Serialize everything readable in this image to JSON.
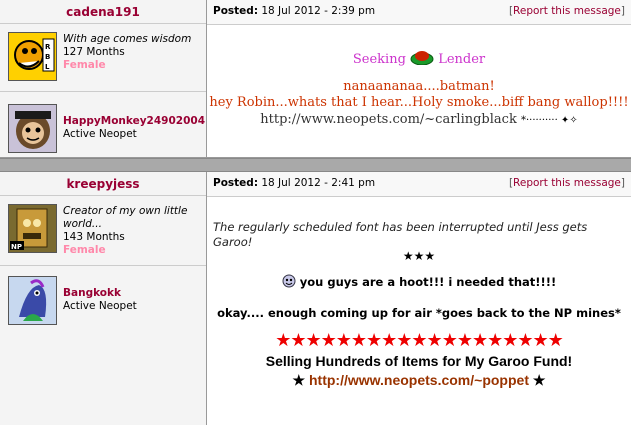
{
  "post1": {
    "username": "cadena191",
    "quote": "With age comes wisdom",
    "months": "127 Months",
    "gender": "Female",
    "pet_name": "HappyMonkey24902004",
    "pet_status": "Active Neopet",
    "posted_label": "Posted:",
    "posted_date": "18 Jul 2012 - 2:39 pm",
    "report_open": "[",
    "report_label": "Report this message",
    "report_close": "]",
    "seeking": "Seeking",
    "lender": "Lender",
    "line1": "nanaananaa....batman!",
    "line2": "hey Robin...whats that I hear...Holy smoke...biff bang wallop!!!!",
    "link": "http://www.neopets.com/~carlingblack",
    "sparkles": "*·········· ✦✧"
  },
  "post2": {
    "username": "kreepyjess",
    "quote": "Creator of my own little world...",
    "months": "143 Months",
    "gender": "Female",
    "pet_name": "Bangkokk",
    "pet_status": "Active Neopet",
    "posted_label": "Posted:",
    "posted_date": "18 Jul 2012 - 2:41 pm",
    "report_open": "[",
    "report_label": "Report this message",
    "report_close": "]",
    "intro": "The regularly scheduled font has been interrupted until Jess gets Garoo!",
    "stars3": "★★★",
    "hoot": "you guys are a hoot!!! i needed that!!!!",
    "okay": "okay.... enough coming up for air *goes back to the NP mines*",
    "red_stars": "★★★★★★★★★★★★★★★★★★★",
    "selling": "Selling Hundreds of Items for My Garoo Fund!",
    "star": "★",
    "link": "http://www.neopets.com/~poppet"
  },
  "colors": {
    "username": "#990033",
    "gender": "#ff88aa",
    "seeking": "#cc33cc",
    "red_text": "#cc3300",
    "link_brown": "#993300",
    "stars_red": "#ee0000"
  }
}
